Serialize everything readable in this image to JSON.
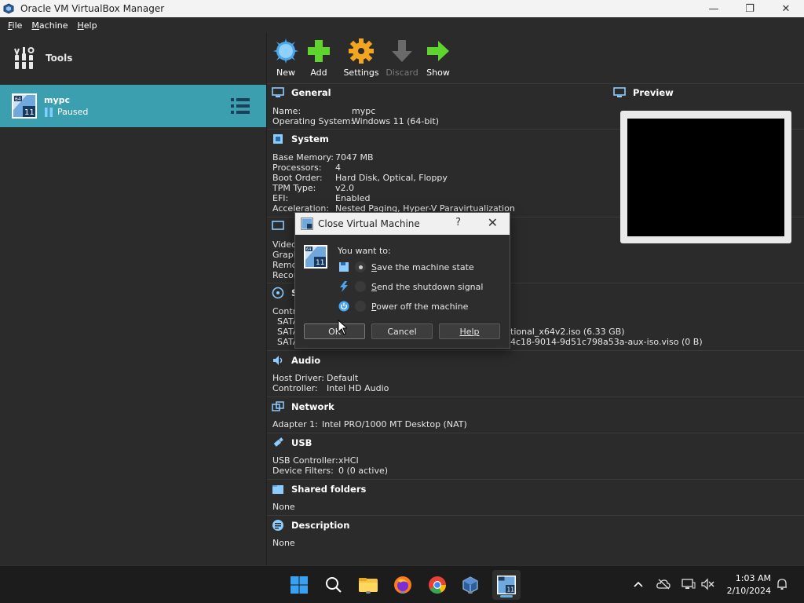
{
  "window": {
    "title": "Oracle VM VirtualBox Manager"
  },
  "menubar": {
    "items": [
      {
        "label": "File",
        "first": "F",
        "rest": "ile"
      },
      {
        "label": "Machine",
        "first": "M",
        "rest": "achine"
      },
      {
        "label": "Help",
        "first": "H",
        "rest": "elp"
      }
    ]
  },
  "sidebar": {
    "tools_label": "Tools",
    "vm": {
      "name": "mypc",
      "status": "Paused"
    }
  },
  "toolbar": {
    "buttons": [
      {
        "label": "New",
        "enabled": true
      },
      {
        "label": "Add",
        "enabled": true
      },
      {
        "label": "Settings",
        "enabled": true
      },
      {
        "label": "Discard",
        "enabled": false
      },
      {
        "label": "Show",
        "enabled": true
      }
    ]
  },
  "details": {
    "general": {
      "title": "General",
      "rows": [
        {
          "k": "Name:",
          "v": "mypc"
        },
        {
          "k": "Operating System:",
          "v": "Windows 11 (64-bit)"
        }
      ]
    },
    "system": {
      "title": "System",
      "rows": [
        {
          "k": "Base Memory:",
          "v": "7047 MB"
        },
        {
          "k": "Processors:",
          "v": "4"
        },
        {
          "k": "Boot Order:",
          "v": "Hard Disk, Optical, Floppy"
        },
        {
          "k": "TPM Type:",
          "v": "v2.0"
        },
        {
          "k": "EFI:",
          "v": "Enabled"
        },
        {
          "k": "Acceleration:",
          "v": "Nested Paging, Hyper-V Paravirtualization"
        }
      ]
    },
    "display_partial": {
      "rows": [
        "Video",
        "Graph",
        "Remo",
        "Recor"
      ]
    },
    "storage_partial": {
      "title_partial": "S",
      "rows": [
        "Contr",
        "SATA",
        "SATA",
        "SATA"
      ],
      "visible_values": [
        "tional_x64v2.iso (6.33 GB)",
        "4c18-9014-9d51c798a53a-aux-iso.viso (0 B)"
      ]
    },
    "audio": {
      "title": "Audio",
      "rows": [
        {
          "k": "Host Driver:",
          "v": "Default"
        },
        {
          "k": "Controller:",
          "v": "Intel HD Audio"
        }
      ]
    },
    "network": {
      "title": "Network",
      "rows": [
        {
          "k": "Adapter 1:",
          "v": "Intel PRO/1000 MT Desktop (NAT)"
        }
      ]
    },
    "usb": {
      "title": "USB",
      "rows": [
        {
          "k": "USB Controller:",
          "v": "xHCI"
        },
        {
          "k": "Device Filters:",
          "v": "0 (0 active)"
        }
      ]
    },
    "shared": {
      "title": "Shared folders",
      "value": "None"
    },
    "description": {
      "title": "Description",
      "value": "None"
    }
  },
  "preview": {
    "title": "Preview"
  },
  "dialog": {
    "title": "Close Virtual Machine",
    "help_glyph": "?",
    "close_glyph": "✕",
    "prompt": "You want to:",
    "options": [
      {
        "label": "Save the machine state",
        "first": "S",
        "rest": "ave the machine state",
        "selected": true
      },
      {
        "label": "Send the shutdown signal",
        "first": "S",
        "rest": "end the shutdown signal",
        "selected": false
      },
      {
        "label": "Power off the machine",
        "first": "P",
        "rest": "ower off the machine",
        "selected": false
      }
    ],
    "buttons": {
      "ok": "OK",
      "cancel": "Cancel",
      "help": "Help"
    }
  },
  "taskbar": {
    "time": "1:03 AM",
    "date": "2/10/2024"
  },
  "colors": {
    "selection": "#3c9fb0",
    "background": "#2b2b2b",
    "accent_green": "#5fd32e",
    "accent_blue": "#49a7ee",
    "accent_orange": "#f2a61f"
  }
}
